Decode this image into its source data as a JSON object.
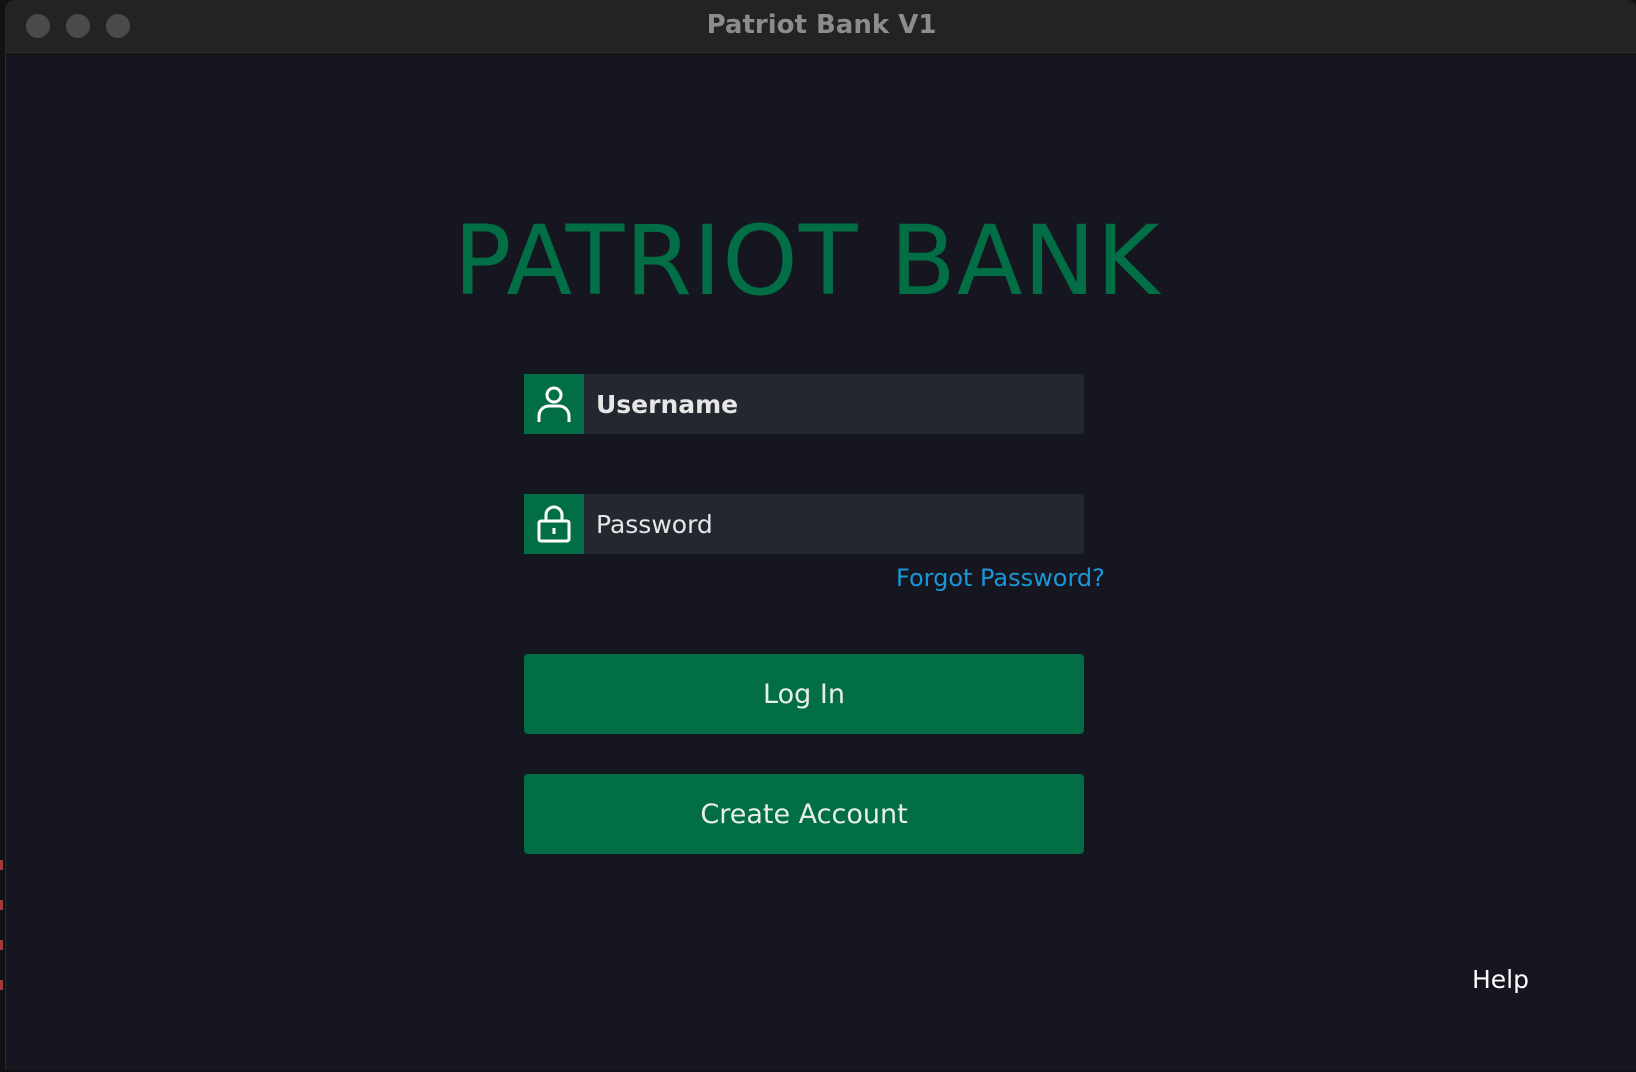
{
  "window": {
    "title": "Patriot Bank V1"
  },
  "login": {
    "logo_text": "PATRIOT BANK",
    "username_placeholder": "Username",
    "password_placeholder": "Password",
    "forgot_password": "Forgot Password?",
    "login_button": "Log In",
    "create_account_button": "Create Account",
    "help": "Help"
  },
  "icons": {
    "username": "user-icon",
    "password": "lock-icon"
  },
  "colors": {
    "brand_green": "#026e45",
    "link_blue": "#1b96d6",
    "background": "#15161f",
    "field_background": "#232830"
  }
}
